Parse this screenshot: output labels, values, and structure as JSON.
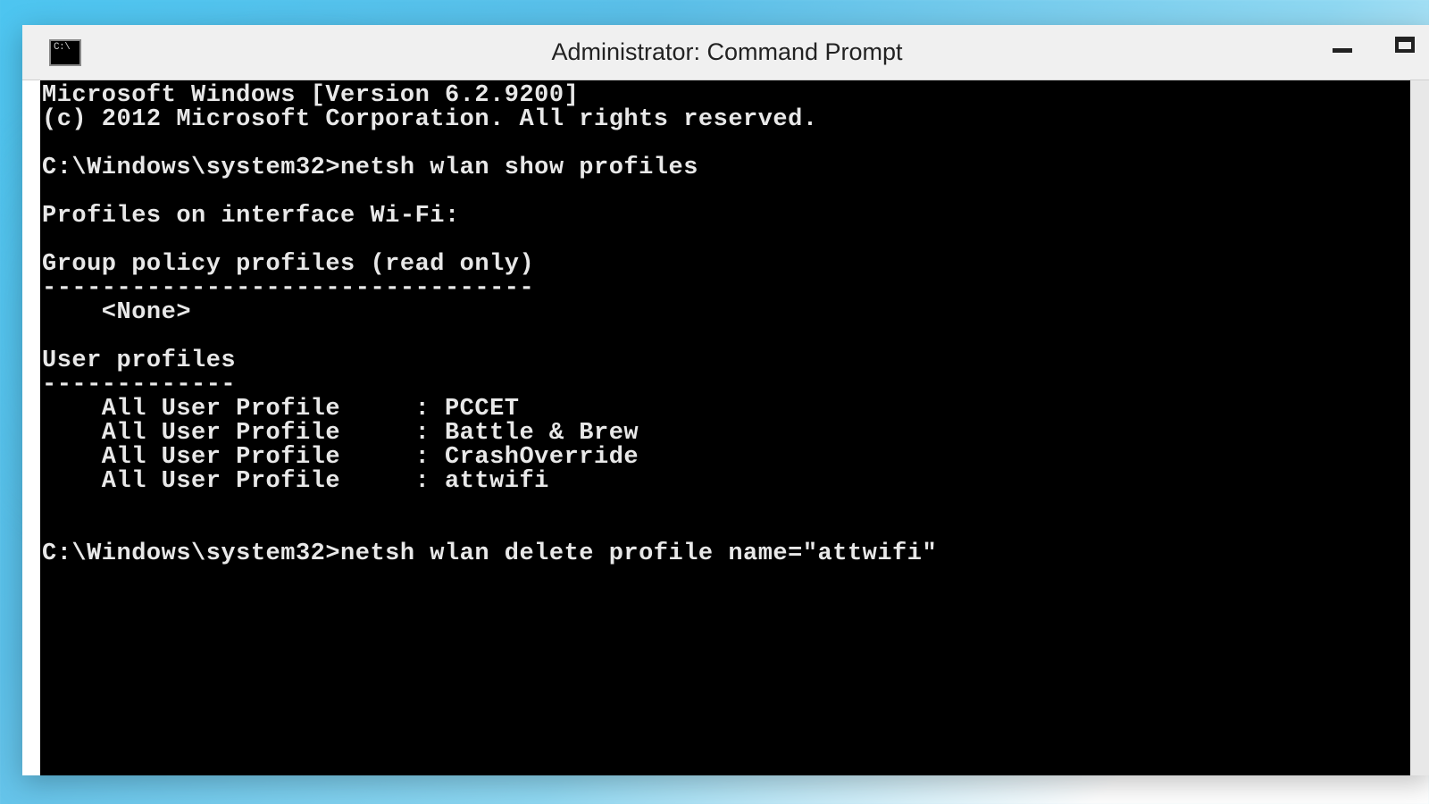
{
  "window": {
    "title": "Administrator: Command Prompt",
    "icon_text": "C:\\"
  },
  "terminal": {
    "lines": [
      "Microsoft Windows [Version 6.2.9200]",
      "(c) 2012 Microsoft Corporation. All rights reserved.",
      "",
      "C:\\Windows\\system32>netsh wlan show profiles",
      "",
      "Profiles on interface Wi-Fi:",
      "",
      "Group policy profiles (read only)",
      "---------------------------------",
      "    <None>",
      "",
      "User profiles",
      "-------------",
      "    All User Profile     : PCCET",
      "    All User Profile     : Battle & Brew",
      "    All User Profile     : CrashOverride",
      "    All User Profile     : attwifi",
      "",
      "",
      "C:\\Windows\\system32>netsh wlan delete profile name=\"attwifi\""
    ]
  }
}
